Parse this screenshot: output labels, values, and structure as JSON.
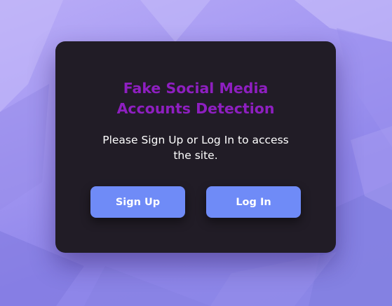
{
  "card": {
    "title": "Fake Social Media Accounts Detection",
    "message": "Please Sign Up or Log In to access the site."
  },
  "buttons": {
    "signup_label": "Sign Up",
    "login_label": "Log In"
  },
  "colors": {
    "background": "#a498f2",
    "card": "#211c26",
    "title": "#8e1fc0",
    "button": "#6f8bf7",
    "button_text": "#ffffff"
  }
}
